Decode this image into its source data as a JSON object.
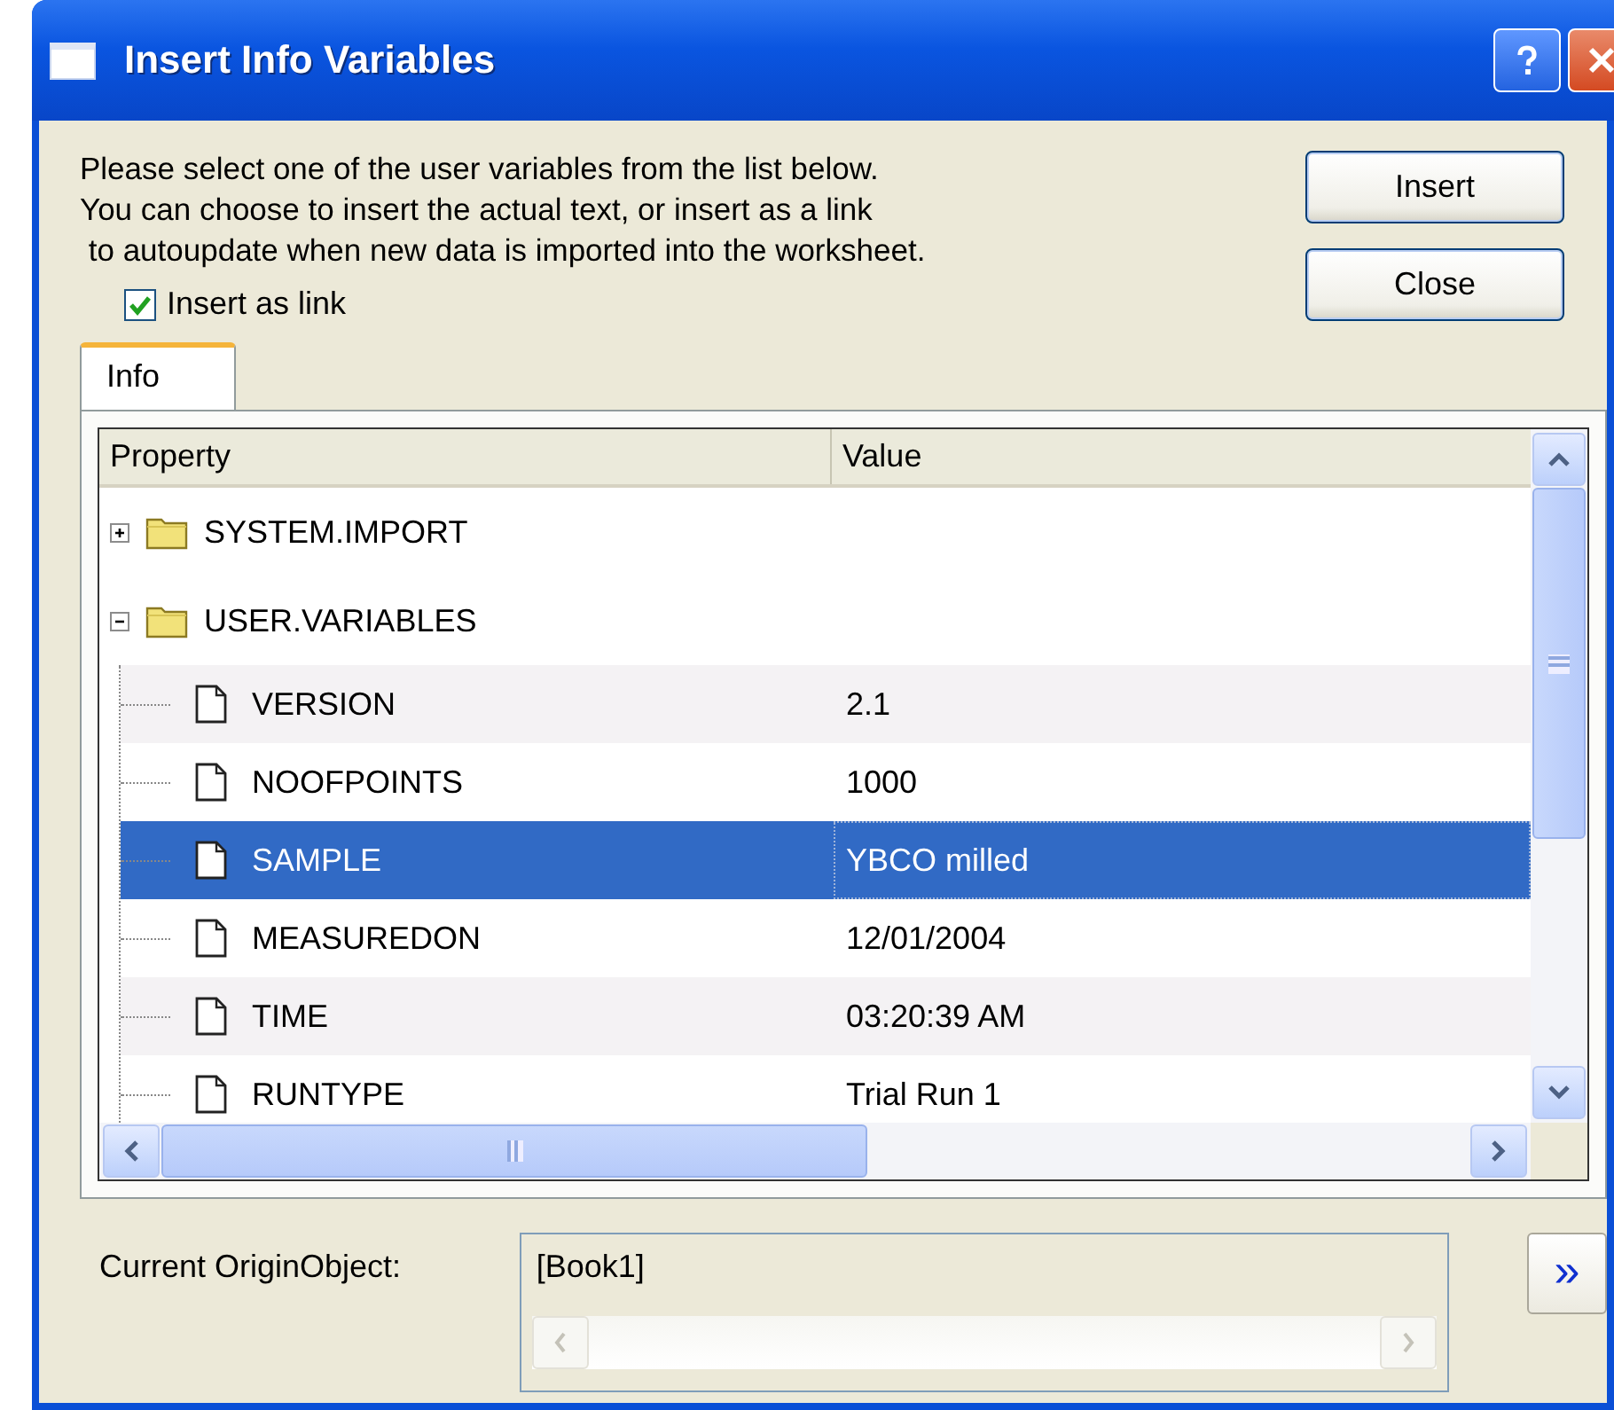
{
  "window": {
    "title": "Insert Info Variables"
  },
  "description": [
    "Please select one of the user variables from the list below.",
    "You can choose to insert the actual text, or insert as a link",
    " to autoupdate when new data is imported into the worksheet."
  ],
  "buttons": [
    "Insert",
    "Close"
  ],
  "insert_as_link": {
    "label": "Insert as link",
    "checked": true
  },
  "tabs": [
    {
      "label": "Info",
      "selected": true
    }
  ],
  "table": {
    "columns": [
      "Property",
      "Value"
    ],
    "tree": [
      {
        "label": "SYSTEM.IMPORT",
        "expanded": false
      },
      {
        "label": "USER.VARIABLES",
        "expanded": true,
        "children": [
          {
            "name": "VERSION",
            "value": "2.1",
            "selected": false
          },
          {
            "name": "NOOFPOINTS",
            "value": "1000",
            "selected": false
          },
          {
            "name": "SAMPLE",
            "value": "YBCO milled",
            "selected": true
          },
          {
            "name": "MEASUREDON",
            "value": "12/01/2004",
            "selected": false
          },
          {
            "name": "TIME",
            "value": "03:20:39 AM",
            "selected": false
          },
          {
            "name": "RUNTYPE",
            "value": "Trial Run 1",
            "selected": false
          }
        ]
      }
    ]
  },
  "current_object": {
    "label": "Current OriginObject:",
    "value": "[Book1]"
  },
  "expand_button": "»"
}
